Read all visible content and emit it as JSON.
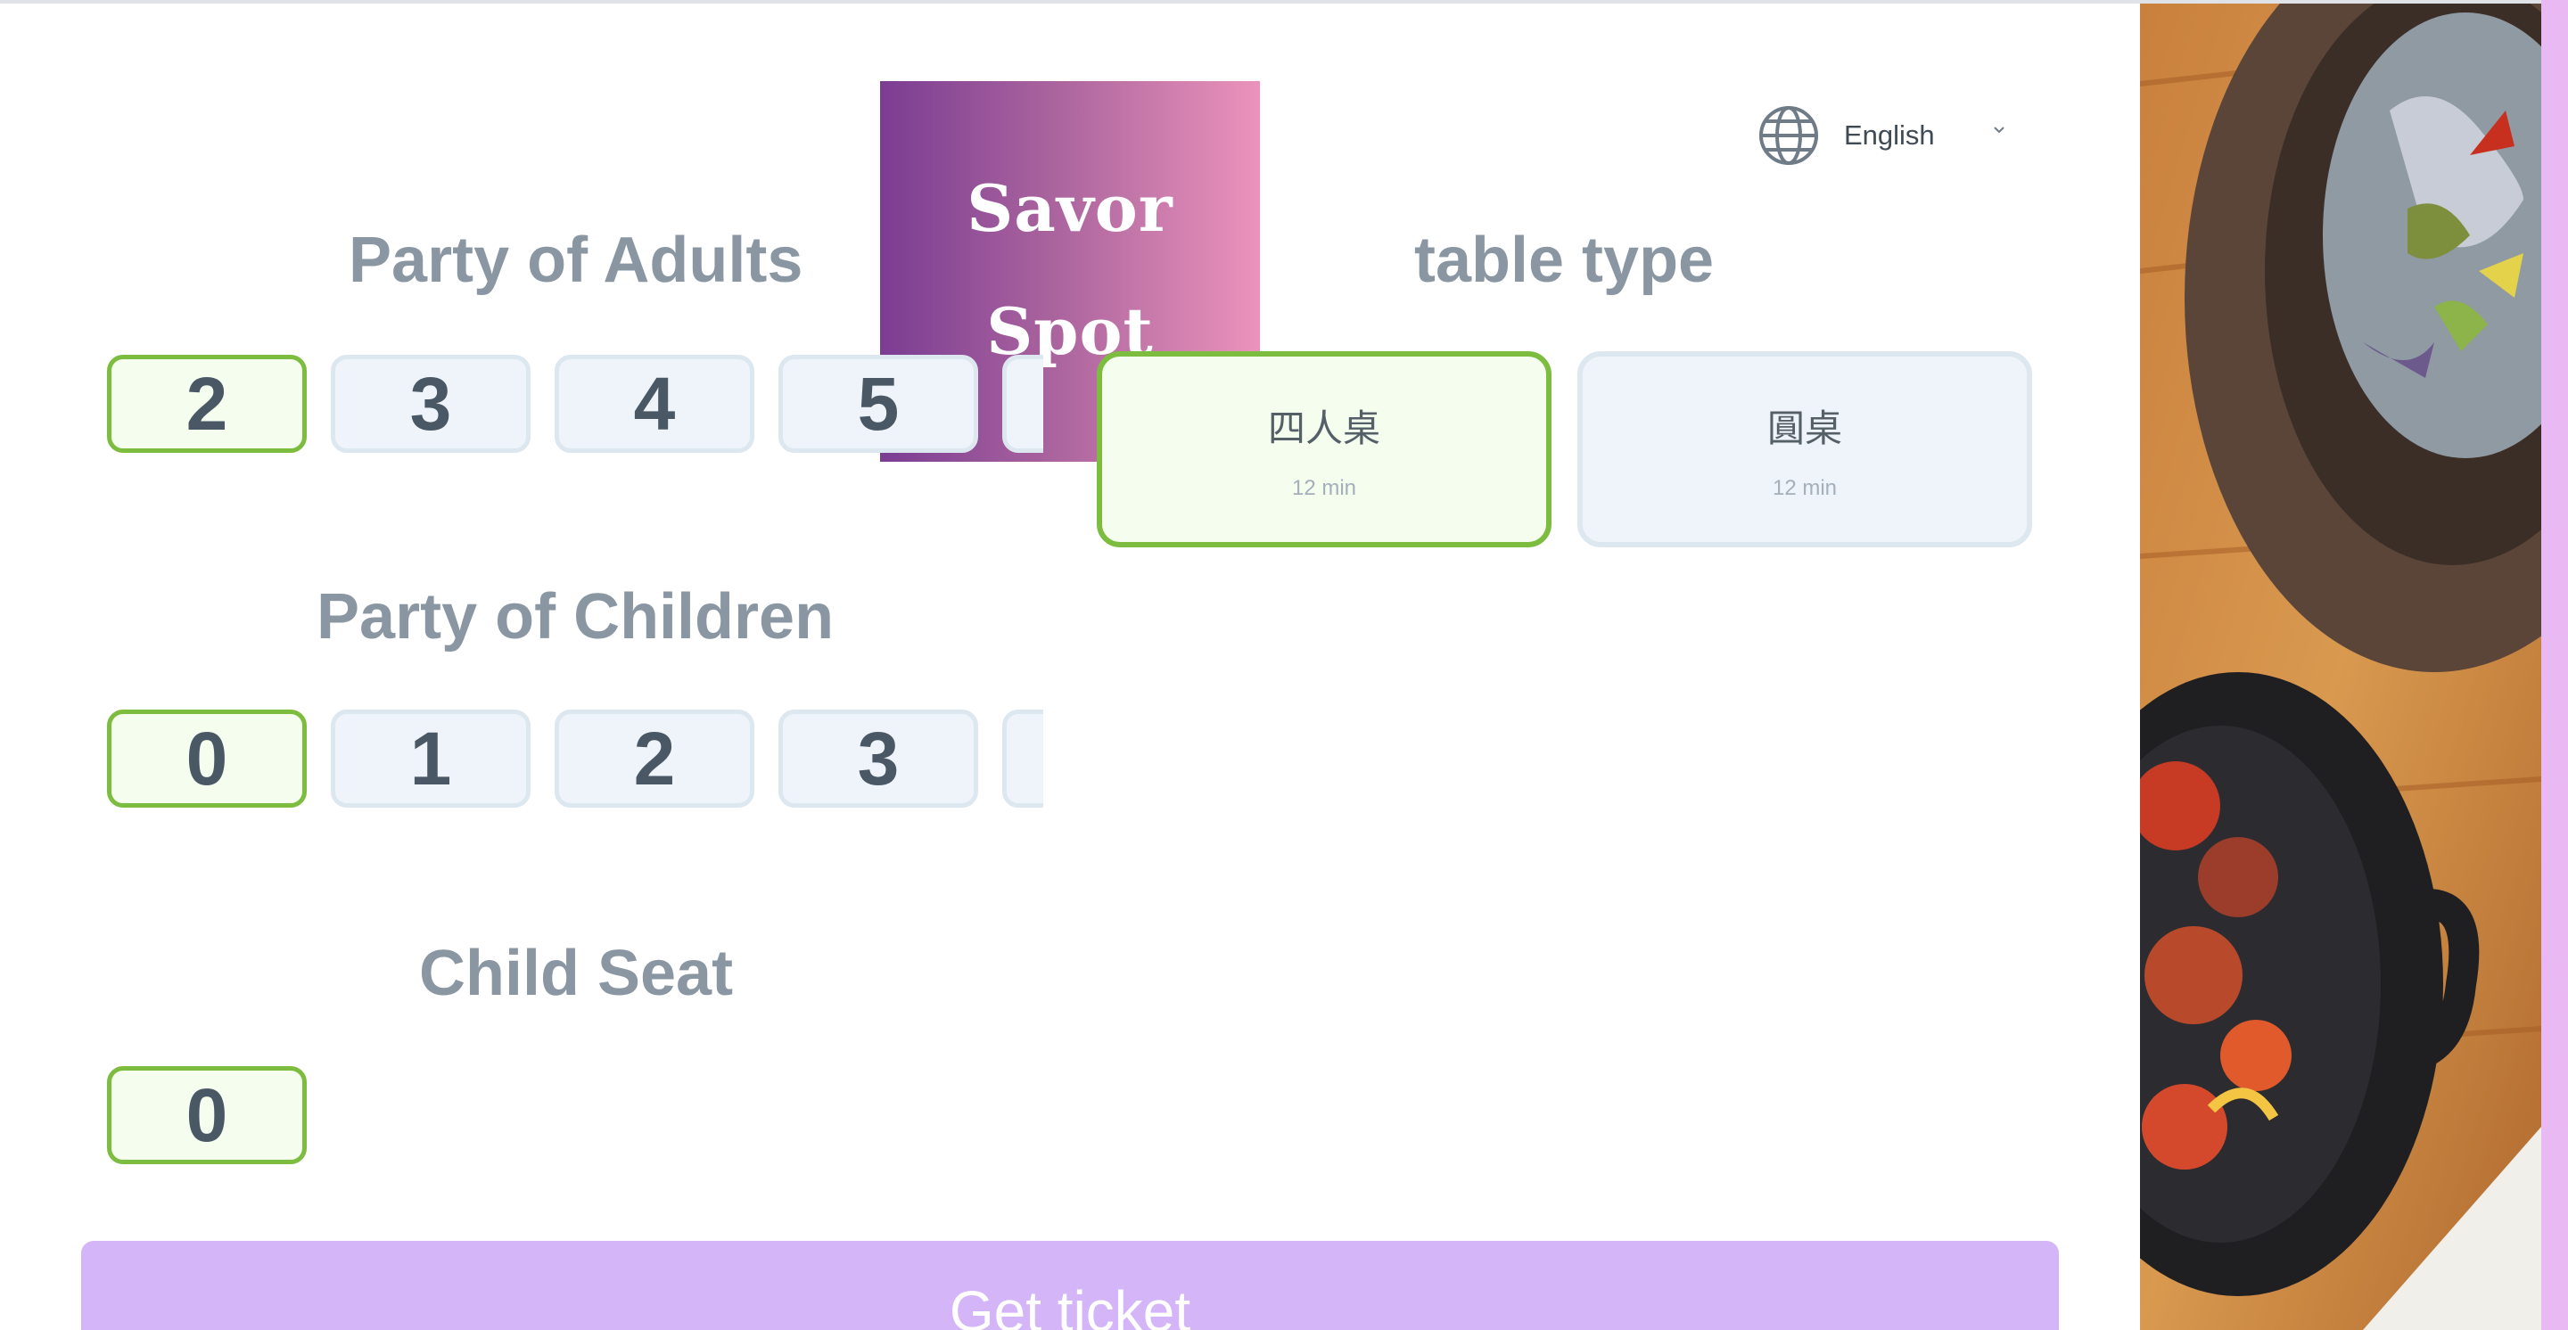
{
  "brand": {
    "logo_line1": "Savor",
    "logo_line2": "Spot",
    "gradient": [
      "#7b3d93",
      "#eb93bb"
    ]
  },
  "language": {
    "icon": "globe-icon",
    "selected": "English",
    "chevron": "chevron-down-icon"
  },
  "adults": {
    "title": "Party of Adults",
    "options": [
      "2",
      "3",
      "4",
      "5"
    ],
    "selected": "2"
  },
  "children": {
    "title": "Party of Children",
    "options": [
      "0",
      "1",
      "2",
      "3"
    ],
    "selected": "0"
  },
  "child_seat": {
    "title": "Child Seat",
    "options": [
      "0"
    ],
    "selected": "0"
  },
  "table_type": {
    "title": "table type",
    "cards": [
      {
        "name": "四人桌",
        "wait": "12 min",
        "selected": true
      },
      {
        "name": "圓桌",
        "wait": "12 min",
        "selected": false
      }
    ]
  },
  "actions": {
    "get_ticket": "Get ticket"
  },
  "colors": {
    "selected_border": "#7cbd3f",
    "option_bg": "#eef4f9",
    "ticket_button": "#d4b5f8",
    "title_text": "#8a97a3"
  }
}
